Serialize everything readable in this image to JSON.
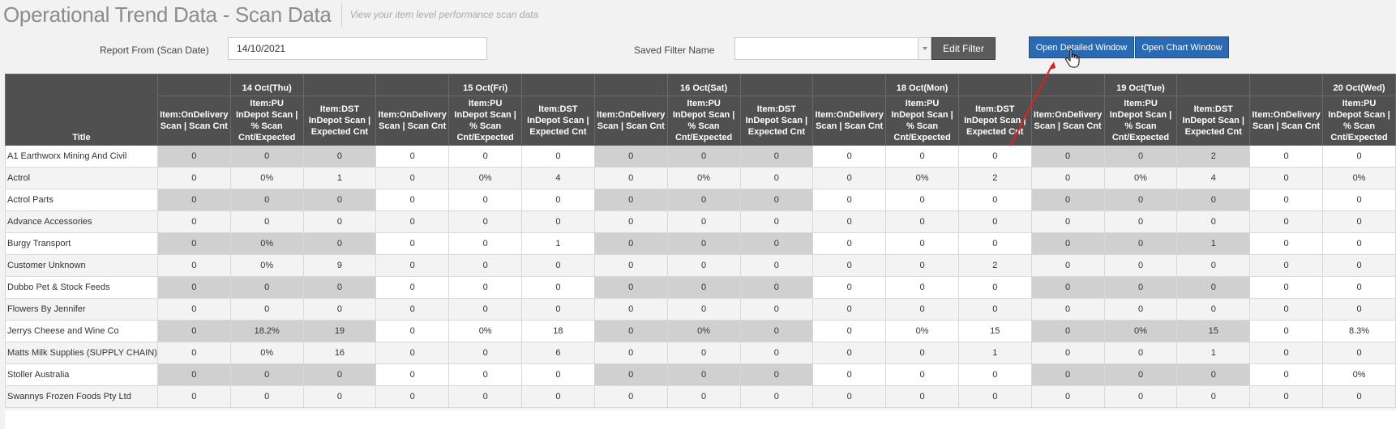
{
  "header": {
    "title": "Operational Trend Data - Scan Data",
    "subtitle": "View your item level performance scan data"
  },
  "filters": {
    "report_from_label": "Report From (Scan Date)",
    "report_from_value": "14/10/2021",
    "saved_filter_label": "Saved Filter Name",
    "saved_filter_value": "",
    "edit_filter_label": "Edit Filter",
    "open_detailed_label": "Open Detailed Window",
    "open_chart_label": "Open Chart Window"
  },
  "table": {
    "title_header": "Title",
    "dates": [
      "14 Oct(Thu)",
      "15 Oct(Fri)",
      "16 Oct(Sat)",
      "18 Oct(Mon)",
      "19 Oct(Tue)",
      "20 Oct(Wed)"
    ],
    "sub_headers": [
      [
        "Item:OnDelivery",
        "Scan | Scan Cnt"
      ],
      [
        "Item:PU",
        "InDepot Scan |",
        "% Scan",
        "Cnt/Expected"
      ],
      [
        "Item:DST",
        "InDepot Scan |",
        "Expected Cnt"
      ]
    ],
    "rows": [
      {
        "title": "A1 Earthworx Mining And Civil",
        "values": [
          "0",
          "0",
          "0",
          "0",
          "0",
          "0",
          "0",
          "0",
          "0",
          "0",
          "0",
          "0",
          "0",
          "0",
          "2",
          "0",
          "0"
        ]
      },
      {
        "title": "Actrol",
        "values": [
          "0",
          "0%",
          "1",
          "0",
          "0%",
          "4",
          "0",
          "0%",
          "0",
          "0",
          "0%",
          "2",
          "0",
          "0%",
          "4",
          "0",
          "0%"
        ]
      },
      {
        "title": "Actrol Parts",
        "values": [
          "0",
          "0",
          "0",
          "0",
          "0",
          "0",
          "0",
          "0",
          "0",
          "0",
          "0",
          "0",
          "0",
          "0",
          "0",
          "0",
          "0"
        ]
      },
      {
        "title": "Advance Accessories",
        "values": [
          "0",
          "0",
          "0",
          "0",
          "0",
          "0",
          "0",
          "0",
          "0",
          "0",
          "0",
          "0",
          "0",
          "0",
          "0",
          "0",
          "0"
        ]
      },
      {
        "title": "Burgy Transport",
        "values": [
          "0",
          "0%",
          "0",
          "0",
          "0",
          "1",
          "0",
          "0",
          "0",
          "0",
          "0",
          "0",
          "0",
          "0",
          "1",
          "0",
          "0"
        ]
      },
      {
        "title": "Customer Unknown",
        "values": [
          "0",
          "0%",
          "9",
          "0",
          "0",
          "0",
          "0",
          "0",
          "0",
          "0",
          "0",
          "2",
          "0",
          "0",
          "0",
          "0",
          "0"
        ]
      },
      {
        "title": "Dubbo Pet & Stock Feeds",
        "values": [
          "0",
          "0",
          "0",
          "0",
          "0",
          "0",
          "0",
          "0",
          "0",
          "0",
          "0",
          "0",
          "0",
          "0",
          "0",
          "0",
          "0"
        ]
      },
      {
        "title": "Flowers By Jennifer",
        "values": [
          "0",
          "0",
          "0",
          "0",
          "0",
          "0",
          "0",
          "0",
          "0",
          "0",
          "0",
          "0",
          "0",
          "0",
          "0",
          "0",
          "0"
        ]
      },
      {
        "title": "Jerrys Cheese and Wine Co",
        "values": [
          "0",
          "18.2%",
          "19",
          "0",
          "0%",
          "18",
          "0",
          "0%",
          "0",
          "0",
          "0%",
          "15",
          "0",
          "0%",
          "15",
          "0",
          "8.3%"
        ]
      },
      {
        "title": "Matts Milk Supplies (SUPPLY CHAIN)",
        "values": [
          "0",
          "0%",
          "16",
          "0",
          "0",
          "6",
          "0",
          "0",
          "0",
          "0",
          "0",
          "1",
          "0",
          "0",
          "1",
          "0",
          "0"
        ]
      },
      {
        "title": "Stoller Australia",
        "values": [
          "0",
          "0",
          "0",
          "0",
          "0",
          "0",
          "0",
          "0",
          "0",
          "0",
          "0",
          "0",
          "0",
          "0",
          "0",
          "0",
          "0%"
        ]
      },
      {
        "title": "Swannys Frozen Foods Pty Ltd",
        "values": [
          "0",
          "0",
          "0",
          "0",
          "0",
          "0",
          "0",
          "0",
          "0",
          "0",
          "0",
          "0",
          "0",
          "0",
          "0",
          "0",
          "0"
        ]
      }
    ]
  },
  "icons": {
    "cursor": "hand-pointer-icon",
    "select_arrow": "chevron-down-icon",
    "annotation": "red-arrow-annotation"
  },
  "colors": {
    "header_bg": "#505050",
    "button_blue": "#2a6ab3",
    "button_dark": "#5b5b5b",
    "shaded_cell": "#d0d0d0",
    "annotation_red": "#e02020"
  }
}
